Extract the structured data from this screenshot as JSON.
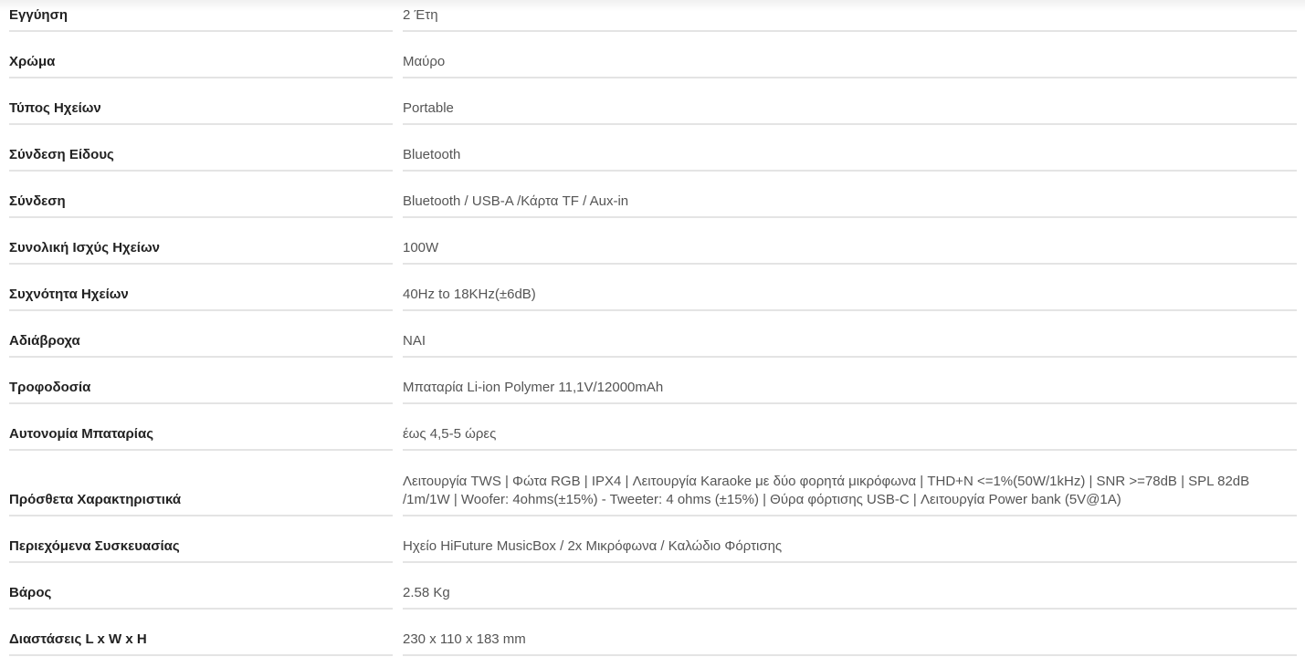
{
  "specs": [
    {
      "label": "Εγγύηση",
      "value": "2 Έτη"
    },
    {
      "label": "Χρώμα",
      "value": "Μαύρο"
    },
    {
      "label": "Τύπος Ηχείων",
      "value": "Portable"
    },
    {
      "label": "Σύνδεση Είδους",
      "value": "Bluetooth"
    },
    {
      "label": "Σύνδεση",
      "value": "Bluetooth / USB-A /Κάρτα TF / Aux-in"
    },
    {
      "label": "Συνολική Ισχύς Ηχείων",
      "value": "100W"
    },
    {
      "label": "Συχνότητα Ηχείων",
      "value": "40Hz to 18KHz(±6dB)"
    },
    {
      "label": "Αδιάβροχα",
      "value": "NAI"
    },
    {
      "label": "Τροφοδοσία",
      "value": "Μπαταρία Li-ion Polymer 11,1V/12000mAh"
    },
    {
      "label": "Αυτονομία Μπαταρίας",
      "value": "έως 4,5-5 ώρες"
    },
    {
      "label": "Πρόσθετα Χαρακτηριστικά",
      "value": "Λειτουργία TWS | Φώτα RGB | IPX4 | Λειτουργία Karaoke με δύο φορητά μικρόφωνα | THD+N <=1%(50W/1kHz) | SNR >=78dB | SPL 82dB /1m/1W | Woofer: 4ohms(±15%) - Tweeter: 4 ohms (±15%) | Θύρα φόρτισης USB-C | Λειτουργία Power bank (5V@1A)"
    },
    {
      "label": "Περιεχόμενα Συσκευασίας",
      "value": "Ηχείο HiFuture MusicBox / 2x Μικρόφωνα / Καλώδιο Φόρτισης"
    },
    {
      "label": "Βάρος",
      "value": "2.58 Kg"
    },
    {
      "label": "Διαστάσεις L x W x H",
      "value": "230 x 110 x 183 mm"
    }
  ]
}
